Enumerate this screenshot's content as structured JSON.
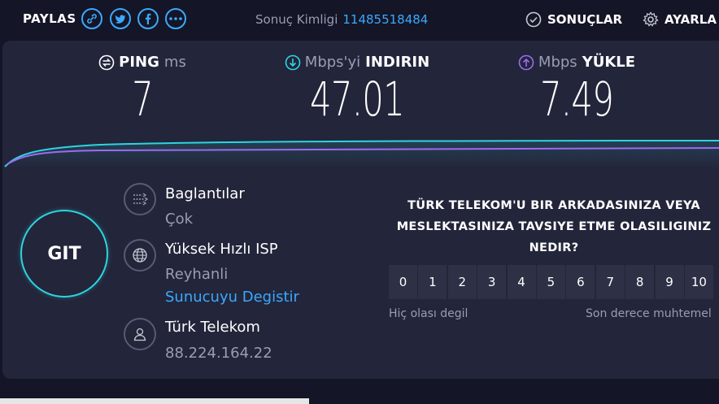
{
  "header": {
    "share_label": "PAYLAS",
    "share_icons": [
      "link-icon",
      "twitter-icon",
      "facebook-icon",
      "more-icon"
    ],
    "result_id_label": "Sonuç Kimligi",
    "result_id_value": "11485518484",
    "results_label": "SONUÇLAR",
    "settings_label": "AYARLA"
  },
  "metrics": {
    "ping": {
      "label": "PING",
      "unit": "ms",
      "value": "7"
    },
    "download": {
      "unit": "Mbps'yi",
      "label": "INDIRIN",
      "value": "47.01"
    },
    "upload": {
      "unit": "Mbps",
      "label": "YÜKLE",
      "value": "7.49"
    }
  },
  "go_button": {
    "label": "GIT"
  },
  "connection": {
    "connections_label": "Baglantılar",
    "connections_value": "Çok",
    "isp_label": "Yüksek Hızlı ISP",
    "server_location": "Reyhanli",
    "change_server_link": "Sunucuyu Degistir",
    "provider_name": "Türk Telekom",
    "ip_address": "88.224.164.22"
  },
  "survey": {
    "question": "TÜRK TELEKOM'U BIR ARKADASINIZA VEYA MESLEKTASINIZA TAVSIYE ETME OLASILIGINIZ NEDIR?",
    "scale": [
      "0",
      "1",
      "2",
      "3",
      "4",
      "5",
      "6",
      "7",
      "8",
      "9",
      "10"
    ],
    "low_label": "Hiç olası degil",
    "high_label": "Son derece muhtemel"
  },
  "colors": {
    "background": "#141526",
    "panel": "#23253a",
    "accent_blue": "#3aa9ff",
    "download_cyan": "#2dd4e0",
    "upload_purple": "#9b6cf0"
  }
}
